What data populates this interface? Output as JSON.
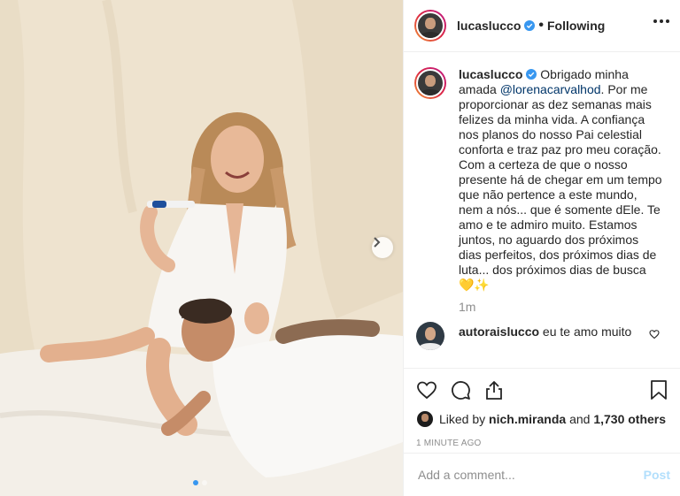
{
  "post": {
    "username": "lucaslucco",
    "verified": true,
    "follow_status": "Following",
    "bullet": "•",
    "photo": {
      "description_icon": "photo",
      "carousel_dots": 2,
      "active_dot": 0
    }
  },
  "caption": {
    "username": "lucaslucco",
    "text_before_mention": "Obrigado minha amada ",
    "mention": "@lorenacarvalhod",
    "text_after_mention": ". Por me proporcionar as dez semanas mais felizes da minha vida. A confiança nos planos do nosso Pai celestial conforta e traz paz pro meu coração. Com a certeza de que o nosso presente há de chegar em um tempo que não pertence a este mundo, nem a nós... que é somente dEle. Te amo e te admiro muito. Estamos juntos, no aguardo dos próximos dias perfeitos, dos próximos dias de luta... dos próximos dias de busca 💛✨",
    "time": "1m"
  },
  "comments": [
    {
      "username": "autoraislucco",
      "text": "eu te amo muito"
    }
  ],
  "likes": {
    "prefix": "Liked by",
    "user": "nich.miranda",
    "conjunction": "and",
    "others": "1,730 others"
  },
  "posted_ago": "1 MINUTE AGO",
  "add_comment": {
    "placeholder": "Add a comment...",
    "post_label": "Post"
  },
  "colors": {
    "verified_blue": "#3897f0",
    "mention_blue": "#003569",
    "post_button_disabled": "#b2dffc",
    "muted_text": "#8e8e8e"
  }
}
